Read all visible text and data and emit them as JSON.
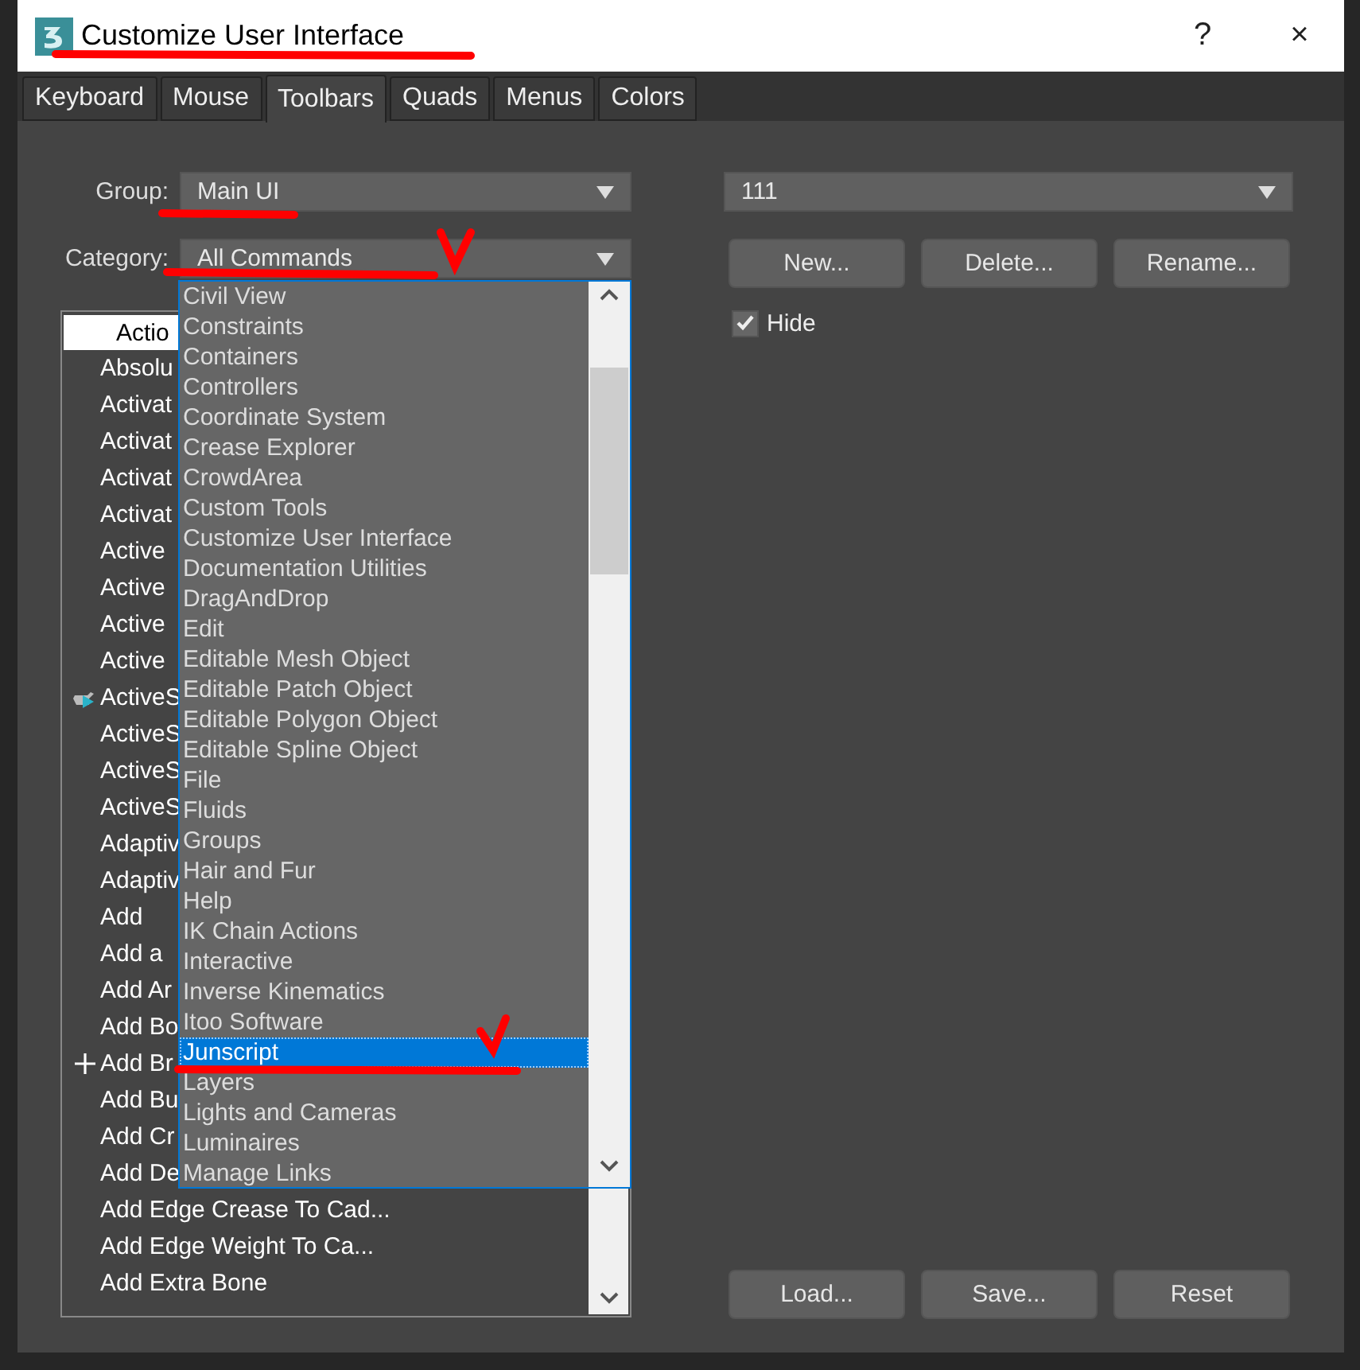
{
  "window": {
    "title": "Customize User Interface",
    "help_button": "?",
    "close_button": "×"
  },
  "tabs": [
    {
      "label": "Keyboard",
      "selected": false
    },
    {
      "label": "Mouse",
      "selected": false
    },
    {
      "label": "Toolbars",
      "selected": true
    },
    {
      "label": "Quads",
      "selected": false
    },
    {
      "label": "Menus",
      "selected": false
    },
    {
      "label": "Colors",
      "selected": false
    }
  ],
  "group": {
    "label": "Group:",
    "value": "Main UI"
  },
  "category": {
    "label": "Category:",
    "value": "All Commands",
    "options": [
      {
        "label": "Civil View",
        "selected": false
      },
      {
        "label": "Constraints",
        "selected": false
      },
      {
        "label": "Containers",
        "selected": false
      },
      {
        "label": "Controllers",
        "selected": false
      },
      {
        "label": "Coordinate System",
        "selected": false
      },
      {
        "label": "Crease Explorer",
        "selected": false
      },
      {
        "label": "CrowdArea",
        "selected": false
      },
      {
        "label": "Custom Tools",
        "selected": false
      },
      {
        "label": "Customize User Interface",
        "selected": false
      },
      {
        "label": "Documentation Utilities",
        "selected": false
      },
      {
        "label": "DragAndDrop",
        "selected": false
      },
      {
        "label": "Edit",
        "selected": false
      },
      {
        "label": "Editable Mesh Object",
        "selected": false
      },
      {
        "label": "Editable Patch Object",
        "selected": false
      },
      {
        "label": "Editable Polygon Object",
        "selected": false
      },
      {
        "label": "Editable Spline Object",
        "selected": false
      },
      {
        "label": "File",
        "selected": false
      },
      {
        "label": "Fluids",
        "selected": false
      },
      {
        "label": "Groups",
        "selected": false
      },
      {
        "label": "Hair and Fur",
        "selected": false
      },
      {
        "label": "Help",
        "selected": false
      },
      {
        "label": "IK Chain Actions",
        "selected": false
      },
      {
        "label": "Interactive",
        "selected": false
      },
      {
        "label": "Inverse Kinematics",
        "selected": false
      },
      {
        "label": "Itoo Software",
        "selected": false
      },
      {
        "label": "Junscript",
        "selected": true
      },
      {
        "label": "Layers",
        "selected": false
      },
      {
        "label": "Lights and Cameras",
        "selected": false
      },
      {
        "label": "Luminaires",
        "selected": false
      },
      {
        "label": "Manage Links",
        "selected": false
      }
    ]
  },
  "actions": {
    "column_header": "Actio",
    "rows": [
      {
        "text": "Absolu",
        "kind": "plain"
      },
      {
        "text": "Activat",
        "kind": "plain"
      },
      {
        "text": "Activat",
        "kind": "plain"
      },
      {
        "text": "Activat",
        "kind": "plain"
      },
      {
        "text": "Activat",
        "kind": "plain"
      },
      {
        "text": "Active",
        "kind": "plain"
      },
      {
        "text": "Active",
        "kind": "plain"
      },
      {
        "text": "Active",
        "kind": "plain"
      },
      {
        "text": "Active",
        "kind": "plain"
      },
      {
        "text": "ActiveS",
        "kind": "teapot"
      },
      {
        "text": "ActiveS",
        "kind": "plain"
      },
      {
        "text": "ActiveS",
        "kind": "plain"
      },
      {
        "text": "ActiveS",
        "kind": "plain"
      },
      {
        "text": "Adaptiv",
        "kind": "plain"
      },
      {
        "text": "Adaptiv",
        "kind": "plain"
      },
      {
        "text": "Add",
        "kind": "plain"
      },
      {
        "text": "Add a",
        "kind": "plain"
      },
      {
        "text": "Add Ar",
        "kind": "plain"
      },
      {
        "text": "Add Bo",
        "kind": "plain"
      },
      {
        "text": "Add Br",
        "kind": "plus"
      },
      {
        "text": "Add Bu",
        "kind": "plain"
      },
      {
        "text": "Add Cr",
        "kind": "plain"
      },
      {
        "text": "Add De",
        "kind": "plain"
      },
      {
        "text": "Add Edge Crease To Cad...",
        "kind": "plain"
      },
      {
        "text": "Add Edge Weight To Ca...",
        "kind": "plain"
      },
      {
        "text": "Add Extra Bone",
        "kind": "plain"
      }
    ]
  },
  "toolbar": {
    "value": "111"
  },
  "toolbar_buttons": [
    "New...",
    "Delete...",
    "Rename..."
  ],
  "hide": {
    "label": "Hide",
    "checked": true
  },
  "file_buttons": [
    "Load...",
    "Save...",
    "Reset"
  ]
}
